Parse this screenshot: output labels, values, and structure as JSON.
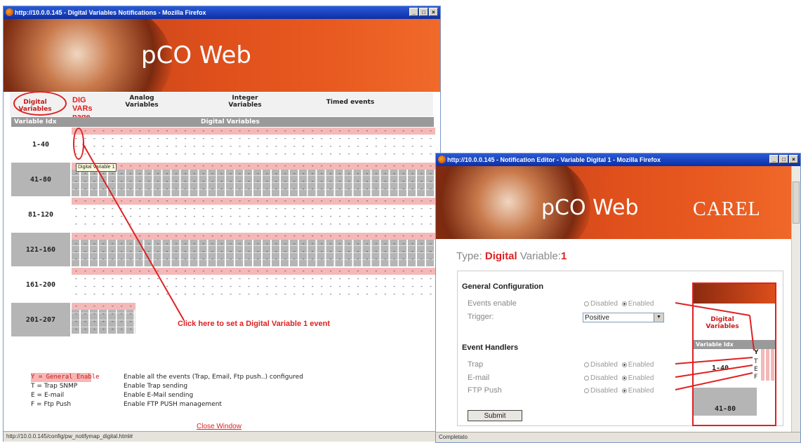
{
  "left_window": {
    "title": "http://10.0.0.145 - Digital Variables Notifications - Mozilla Firefox",
    "logo": "pCO Web",
    "nav": {
      "digital": "Digital Variables",
      "analog": "Analog Variables",
      "integer": "Integer Variables",
      "timed": "Timed events"
    },
    "annotation_page": "DIG VARs page",
    "grid_header_idx": "Variable Idx",
    "grid_header_vars": "Digital Variables",
    "rows": [
      "1-40",
      "41-80",
      "81-120",
      "121-160",
      "161-200",
      "201-207"
    ],
    "tooltip": "Digital Variable 1",
    "annotation_click": "Click here to set a Digital Variable 1 event",
    "legend": [
      {
        "key": "Y = General Enable",
        "desc": "Enable all the events (Trap, Email, Ftp push..) configured"
      },
      {
        "key": "T = Trap SNMP",
        "desc": "Enable Trap sending"
      },
      {
        "key": "E = E-mail",
        "desc": "Enable E-Mail sending"
      },
      {
        "key": "F = Ftp Push",
        "desc": "Enable FTP PUSH management"
      }
    ],
    "close_link": "Close Window",
    "status": "http://10.0.0.145/config/pw_notifymap_digital.html#"
  },
  "right_window": {
    "title": "http://10.0.0.145 - Notification Editor - Variable Digital 1 - Mozilla Firefox",
    "logo": "pCO Web",
    "brand": "CAREL",
    "type_label": "Type:",
    "type_value": "Digital",
    "var_label": "Variable:",
    "var_value": "1",
    "general_config": "General Configuration",
    "events_enable": "Events enable",
    "trigger": "Trigger:",
    "trigger_value": "Positive",
    "event_handlers": "Event Handlers",
    "trap": "Trap",
    "email": "E-mail",
    "ftp": "FTP Push",
    "disabled": "Disabled",
    "enabled": "Enabled",
    "submit": "Submit",
    "mini_title": "Digital Variables",
    "mini_header": "Variable Idx",
    "mini_row1": "1-40",
    "mini_row2": "41-80",
    "mini_letters": [
      "Y",
      "T",
      "E",
      "F"
    ],
    "status": "Completato"
  },
  "colors": {
    "annotation_red": "#e02020",
    "row_pink": "#f4b8b8",
    "row_grey": "#b5b5b5"
  }
}
